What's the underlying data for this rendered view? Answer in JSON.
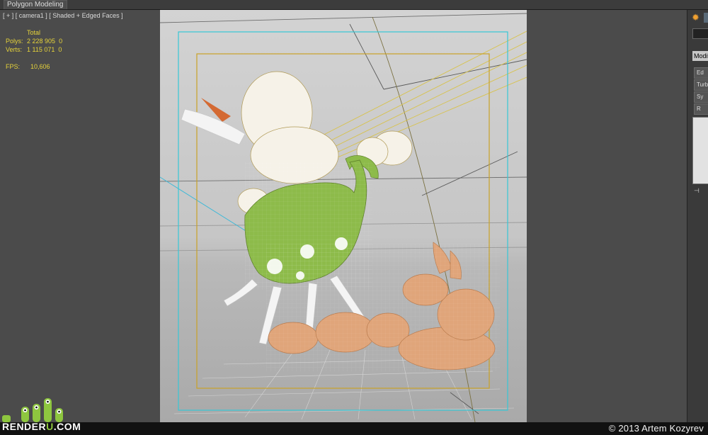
{
  "ribbon": {
    "tab_label": "Polygon Modeling"
  },
  "viewport": {
    "label": "[ + ] [ camera1 ] [ Shaded + Edged Faces ]",
    "stats": {
      "header": "Total",
      "polys_label": "Polys:",
      "polys_value": "2 228 905",
      "polys_sel": "0",
      "verts_label": "Verts:",
      "verts_value": "1 115 071",
      "verts_sel": "0",
      "fps_label": "FPS:",
      "fps_value": "10,606"
    }
  },
  "command_panel": {
    "modify_label": "Modifi",
    "buttons": [
      "Ed",
      "Turb",
      "Sy",
      "R"
    ]
  },
  "watermark": {
    "logo_text_pre": "RENDER",
    "logo_text_u": "U",
    "logo_text_post": ".COM"
  },
  "credit": "© 2013 Artem Kozyrev",
  "colors": {
    "safe_frame_outer": "#36c7d6",
    "safe_frame_inner": "#c9a227",
    "stats_yellow": "#e6d33a",
    "body_green": "#8dbb4a",
    "tail_orange": "#e0a57a",
    "logo_green": "#8ec63f"
  }
}
